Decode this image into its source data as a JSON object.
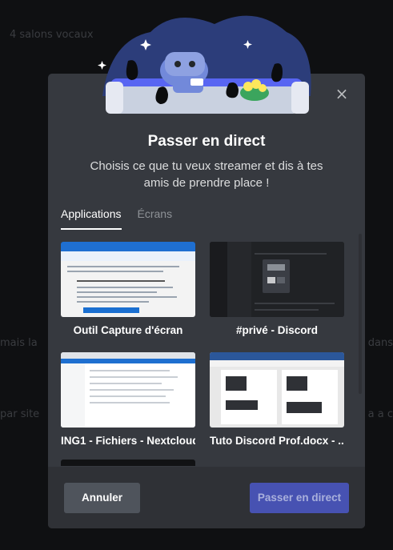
{
  "background": {
    "top_text": "4 salons vocaux",
    "left_text_1": "mais la",
    "right_text_1": "dans",
    "left_text_2": "par site",
    "right_text_2": "a a c"
  },
  "modal": {
    "title": "Passer en direct",
    "subtitle": "Choisis ce que tu veux streamer et dis à tes amis de prendre place !",
    "close_icon": "×",
    "tabs": [
      {
        "label": "Applications",
        "active": true
      },
      {
        "label": "Écrans",
        "active": false
      }
    ],
    "sources": [
      {
        "label": "Outil Capture d'écran",
        "thumb": "snipping-tool"
      },
      {
        "label": "#privé - Discord",
        "thumb": "discord"
      },
      {
        "label": "ING1 - Fichiers - Nextcloud...",
        "thumb": "nextcloud"
      },
      {
        "label": "Tuto Discord Prof.docx - ...",
        "thumb": "word-doc"
      }
    ],
    "footer": {
      "cancel_label": "Annuler",
      "go_live_label": "Passer en direct"
    }
  },
  "colors": {
    "modal_bg": "#36393f",
    "footer_bg": "#2f3136",
    "primary": "#4752b2",
    "cancel": "#4f545c"
  }
}
